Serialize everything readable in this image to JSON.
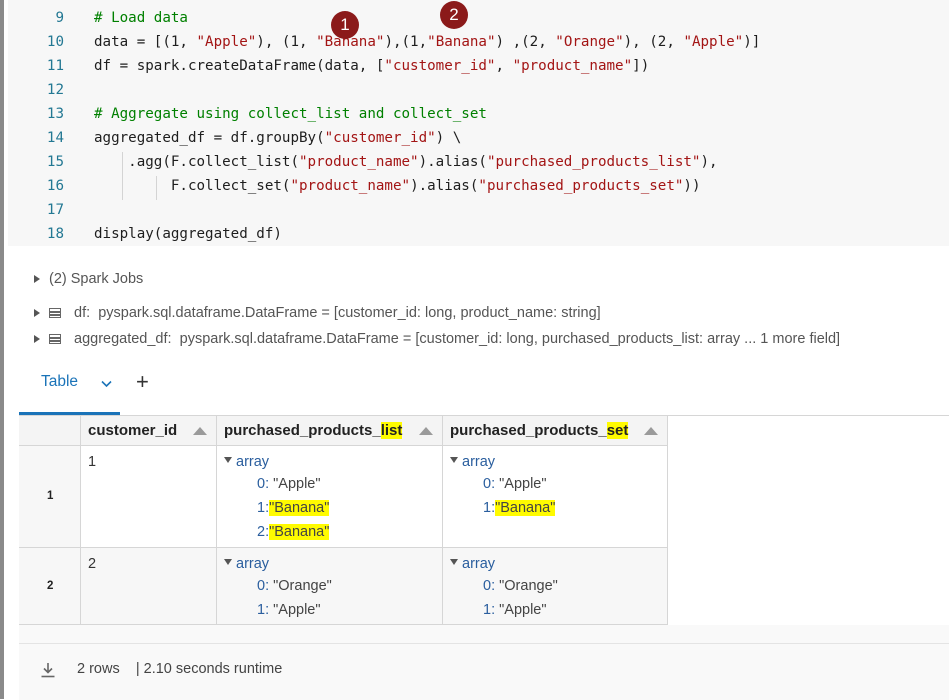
{
  "code": {
    "lines": [
      {
        "num": "9",
        "tokens": [
          {
            "t": "# Load data",
            "c": "cm"
          }
        ]
      },
      {
        "num": "10",
        "tokens": [
          {
            "t": "data = [(1, ",
            "c": ""
          },
          {
            "t": "\"Apple\"",
            "c": "st"
          },
          {
            "t": "), (1, ",
            "c": ""
          },
          {
            "t": "\"Banana\"",
            "c": "st"
          },
          {
            "t": "),(1,",
            "c": ""
          },
          {
            "t": "\"Banana\"",
            "c": "st"
          },
          {
            "t": ") ,(2, ",
            "c": ""
          },
          {
            "t": "\"Orange\"",
            "c": "st"
          },
          {
            "t": "), (2, ",
            "c": ""
          },
          {
            "t": "\"Apple\"",
            "c": "st"
          },
          {
            "t": ")]",
            "c": ""
          }
        ]
      },
      {
        "num": "11",
        "tokens": [
          {
            "t": "df = spark.createDataFrame(data, [",
            "c": ""
          },
          {
            "t": "\"customer_id\"",
            "c": "st"
          },
          {
            "t": ", ",
            "c": ""
          },
          {
            "t": "\"product_name\"",
            "c": "st"
          },
          {
            "t": "])",
            "c": ""
          }
        ]
      },
      {
        "num": "12",
        "tokens": []
      },
      {
        "num": "13",
        "tokens": [
          {
            "t": "# Aggregate using collect_list and collect_set",
            "c": "cm"
          }
        ]
      },
      {
        "num": "14",
        "tokens": [
          {
            "t": "aggregated_df = df.groupBy(",
            "c": ""
          },
          {
            "t": "\"customer_id\"",
            "c": "st"
          },
          {
            "t": ") \\",
            "c": ""
          }
        ]
      },
      {
        "num": "15",
        "tokens": [
          {
            "t": "    .agg(F.collect_list(",
            "c": ""
          },
          {
            "t": "\"product_name\"",
            "c": "st"
          },
          {
            "t": ").alias(",
            "c": ""
          },
          {
            "t": "\"purchased_products_list\"",
            "c": "st"
          },
          {
            "t": "),",
            "c": ""
          }
        ]
      },
      {
        "num": "16",
        "tokens": [
          {
            "t": "         F.collect_set(",
            "c": ""
          },
          {
            "t": "\"product_name\"",
            "c": "st"
          },
          {
            "t": ").alias(",
            "c": ""
          },
          {
            "t": "\"purchased_products_set\"",
            "c": "st"
          },
          {
            "t": "))",
            "c": ""
          }
        ]
      },
      {
        "num": "17",
        "tokens": []
      },
      {
        "num": "18",
        "tokens": [
          {
            "t": "display(aggregated_df)",
            "c": ""
          }
        ]
      }
    ]
  },
  "markers": {
    "m1": "1",
    "m2": "2"
  },
  "output": {
    "spark_jobs": "(2) Spark Jobs",
    "df_label": "df:",
    "df_schema": "pyspark.sql.dataframe.DataFrame = [customer_id: long, product_name: string]",
    "agg_label": "aggregated_df:",
    "agg_schema": "pyspark.sql.dataframe.DataFrame = [customer_id: long, purchased_products_list: array ... 1 more field]"
  },
  "table_view": {
    "tab_label": "Table",
    "add_tab": "+",
    "headers": {
      "customer_id": "customer_id",
      "list_prefix": "purchased_products_",
      "list_suffix": "list",
      "set_prefix": "purchased_products_",
      "set_suffix": "set"
    },
    "array_label": "array",
    "rows": [
      {
        "num": "1",
        "customer_id": "1",
        "list_items": [
          {
            "idx": "0:",
            "val": "\"Apple\""
          },
          {
            "idx": "1:",
            "val": "\"Banana\""
          },
          {
            "idx": "2:",
            "val": "\"Banana\""
          }
        ],
        "set_items": [
          {
            "idx": "0:",
            "val": "\"Apple\""
          },
          {
            "idx": "1:",
            "val": "\"Banana\""
          }
        ]
      },
      {
        "num": "2",
        "customer_id": "2",
        "list_items": [
          {
            "idx": "0:",
            "val": "\"Orange\""
          },
          {
            "idx": "1:",
            "val": "\"Apple\""
          }
        ],
        "set_items": [
          {
            "idx": "0:",
            "val": "\"Orange\""
          },
          {
            "idx": "1:",
            "val": "\"Apple\""
          }
        ]
      }
    ],
    "footer": {
      "rows": "2 rows",
      "runtime": "|  2.10 seconds runtime"
    }
  },
  "colors": {
    "highlight": "#fffb00",
    "marker": "#8b1a1a",
    "tab_accent": "#1a73b8"
  }
}
